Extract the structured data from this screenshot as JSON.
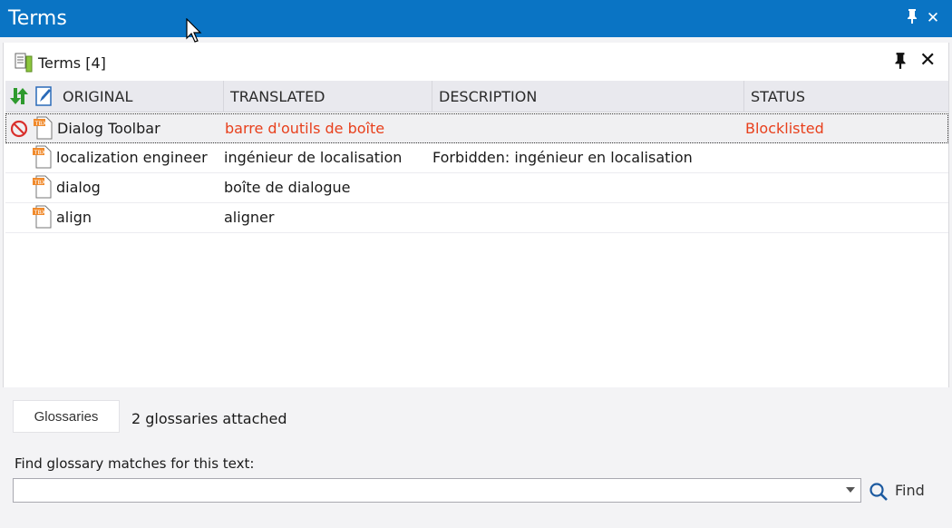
{
  "window": {
    "title": "Terms"
  },
  "panel": {
    "title": "Terms [4]"
  },
  "columns": [
    "ORIGINAL",
    "TRANSLATED",
    "DESCRIPTION",
    "STATUS"
  ],
  "rows": [
    {
      "original": "Dialog Toolbar",
      "translated": "barre d'outils de boîte",
      "description": "",
      "status": "Blocklisted",
      "blocked": true
    },
    {
      "original": "localization engineer",
      "translated": "ingénieur de localisation",
      "description": "Forbidden: ingénieur en localisation",
      "status": ""
    },
    {
      "original": "dialog",
      "translated": "boîte de dialogue",
      "description": "",
      "status": ""
    },
    {
      "original": "align",
      "translated": "aligner",
      "description": "",
      "status": ""
    }
  ],
  "footer": {
    "glossaries_button": "Glossaries",
    "glossaries_count": "2 glossaries attached",
    "find_label": "Find glossary matches for this text:",
    "find_value": "",
    "find_button": "Find"
  },
  "colors": {
    "titlebar": "#0a74c4",
    "blocked": "#e8401c"
  },
  "icons": [
    "pin-icon",
    "close-icon",
    "sync-icon",
    "edit-icon",
    "tbx-file-icon",
    "blocked-icon",
    "search-icon",
    "document-icon"
  ]
}
